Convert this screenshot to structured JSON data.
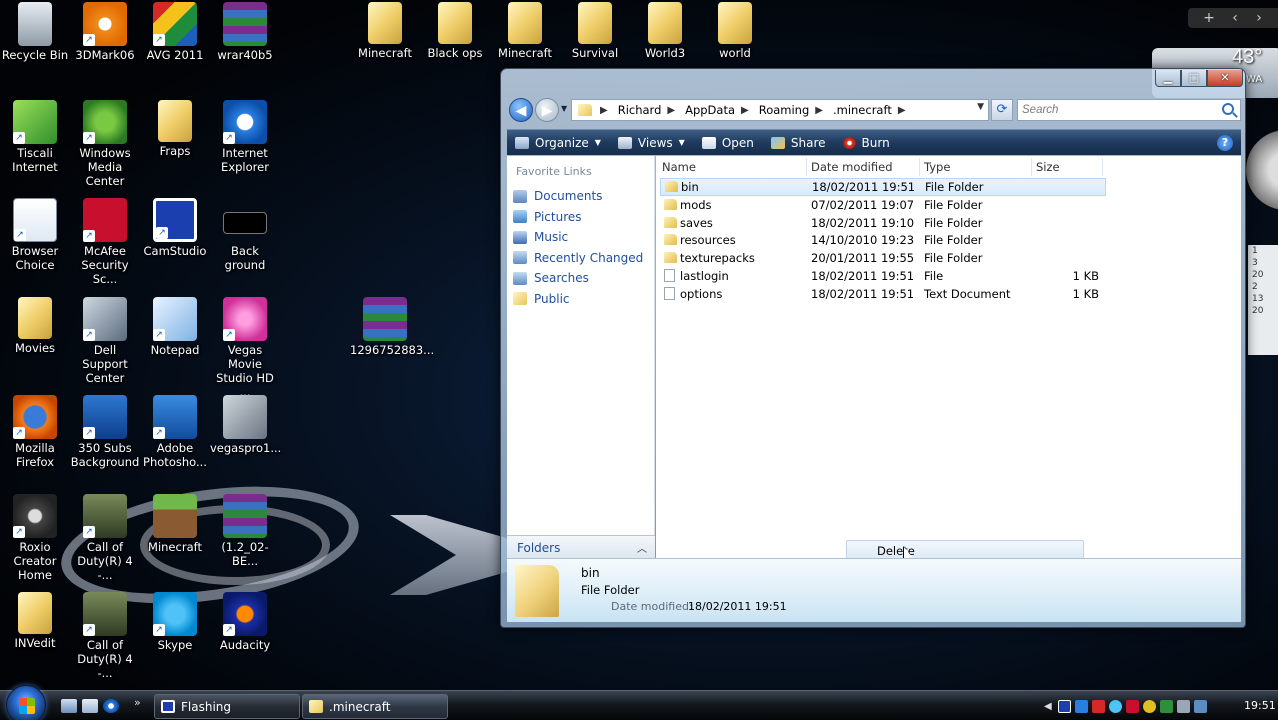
{
  "desktop": {
    "icons": [
      {
        "label": "Recycle Bin",
        "icon": "recycle-bin-icon"
      },
      {
        "label": "3DMark06",
        "icon": "3dmark-icon"
      },
      {
        "label": "AVG 2011",
        "icon": "avg-icon"
      },
      {
        "label": "wrar40b5",
        "icon": "winrar-icon"
      },
      {
        "label": "Minecraft",
        "icon": "folder-icon"
      },
      {
        "label": "Black ops",
        "icon": "folder-icon"
      },
      {
        "label": "Minecraft",
        "icon": "folder-icon"
      },
      {
        "label": "Survival",
        "icon": "folder-icon"
      },
      {
        "label": "World3",
        "icon": "folder-icon"
      },
      {
        "label": "world",
        "icon": "folder-icon"
      },
      {
        "label": "Tiscali Internet",
        "icon": "tiscali-icon"
      },
      {
        "label": "Windows Media Center",
        "icon": "media-center-icon"
      },
      {
        "label": "Fraps",
        "icon": "folder-icon"
      },
      {
        "label": "Internet Explorer",
        "icon": "internet-explorer-icon"
      },
      {
        "label": "Browser Choice",
        "icon": "browser-choice-icon"
      },
      {
        "label": "McAfee Security Sc...",
        "icon": "mcafee-icon"
      },
      {
        "label": "CamStudio",
        "icon": "camstudio-icon"
      },
      {
        "label": "Back ground",
        "icon": "background-icon"
      },
      {
        "label": "Movies",
        "icon": "folder-icon"
      },
      {
        "label": "Dell Support Center",
        "icon": "dell-support-icon"
      },
      {
        "label": "Notepad",
        "icon": "notepad-icon"
      },
      {
        "label": "Vegas Movie Studio HD ...",
        "icon": "vegas-icon"
      },
      {
        "label": "1296752883...",
        "icon": "winrar-archive-icon"
      },
      {
        "label": "Mozilla Firefox",
        "icon": "firefox-icon"
      },
      {
        "label": "350 Subs Background",
        "icon": "psd-file-icon"
      },
      {
        "label": "Adobe Photosho...",
        "icon": "photoshop-elements-icon"
      },
      {
        "label": "vegaspro1...",
        "icon": "installer-icon"
      },
      {
        "label": "Roxio Creator Home",
        "icon": "roxio-icon"
      },
      {
        "label": "Call of Duty(R) 4 -...",
        "icon": "call-of-duty-icon"
      },
      {
        "label": "Minecraft",
        "icon": "minecraft-icon"
      },
      {
        "label": "(1.2_02-BE...",
        "icon": "winrar-archive-icon"
      },
      {
        "label": "INVedit",
        "icon": "folder-icon"
      },
      {
        "label": "Call of Duty(R) 4 -...",
        "icon": "call-of-duty-icon"
      },
      {
        "label": "Skype",
        "icon": "skype-icon"
      },
      {
        "label": "Audacity",
        "icon": "audacity-icon"
      }
    ]
  },
  "gadgets": {
    "weather_temp": "43°",
    "weather_loc": "WA",
    "calendar_text": "1\n3\n20\n2\n13\n20"
  },
  "explorer": {
    "breadcrumb": [
      "Richard",
      "AppData",
      "Roaming",
      ".minecraft"
    ],
    "search_placeholder": "Search",
    "toolbar": {
      "organize": "Organize",
      "views": "Views",
      "open": "Open",
      "share": "Share",
      "burn": "Burn",
      "help": "?"
    },
    "nav": {
      "heading": "Favorite Links",
      "items": [
        "Documents",
        "Pictures",
        "Music",
        "Recently Changed",
        "Searches",
        "Public"
      ],
      "folders_label": "Folders"
    },
    "columns": {
      "name": "Name",
      "date": "Date modified",
      "type": "Type",
      "size": "Size"
    },
    "files": [
      {
        "name": "bin",
        "date": "18/02/2011 19:51",
        "type": "File Folder",
        "size": "",
        "kind": "folder",
        "selected": true
      },
      {
        "name": "mods",
        "date": "07/02/2011 19:07",
        "type": "File Folder",
        "size": "",
        "kind": "folder",
        "selected": false
      },
      {
        "name": "saves",
        "date": "18/02/2011 19:10",
        "type": "File Folder",
        "size": "",
        "kind": "folder",
        "selected": false
      },
      {
        "name": "resources",
        "date": "14/10/2010 19:23",
        "type": "File Folder",
        "size": "",
        "kind": "folder",
        "selected": false
      },
      {
        "name": "texturepacks",
        "date": "20/01/2011 19:55",
        "type": "File Folder",
        "size": "",
        "kind": "folder",
        "selected": false
      },
      {
        "name": "lastlogin",
        "date": "18/02/2011 19:51",
        "type": "File",
        "size": "1 KB",
        "kind": "file",
        "selected": false
      },
      {
        "name": "options",
        "date": "18/02/2011 19:51",
        "type": "Text Document",
        "size": "1 KB",
        "kind": "file",
        "selected": false
      }
    ],
    "context_menu_item": "Delete",
    "details": {
      "name": "bin",
      "type": "File Folder",
      "modified_label": "Date modified:",
      "modified_value": "18/02/2011 19:51"
    }
  },
  "taskbar": {
    "tasks": [
      "Flashing",
      ".minecraft"
    ],
    "quick_more": "»",
    "clock": "19:51"
  }
}
